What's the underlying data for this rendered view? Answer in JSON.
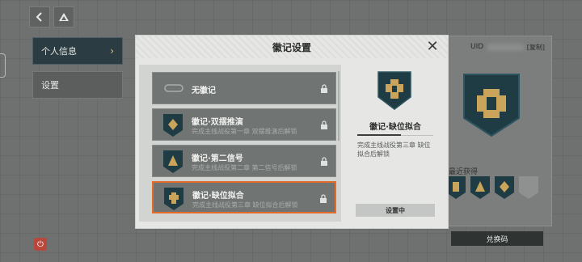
{
  "dialog": {
    "title": "徽记设置",
    "items": [
      {
        "name": "无徽记",
        "desc": ""
      },
      {
        "name": "徽记·双摆推演",
        "desc": "完成主线战役第一章 双摆推演后解锁"
      },
      {
        "name": "徽记·第二信号",
        "desc": "完成主线战役第二章 第二信号后解锁"
      },
      {
        "name": "徽记·缺位拟合",
        "desc": "完成主线战役第三章 缺位拟合后解锁"
      }
    ],
    "selected_index": 3,
    "detail": {
      "name": "徽记·缺位拟合",
      "desc": "完成主线战役第三章 缺位拟合后解锁",
      "button": "设置中"
    }
  },
  "sidebar": {
    "items": [
      {
        "label": "个人信息"
      },
      {
        "label": "设置"
      }
    ]
  },
  "profile": {
    "uid_label": "UID",
    "copy_label": "[复制]",
    "recent_label": "最近获得",
    "exchange_button": "兑换码"
  },
  "icons": {
    "back": "back-arrow-icon",
    "drive": "triangle-logo-icon",
    "close": "close-icon",
    "lock": "lock-icon",
    "power": "power-icon",
    "chevron": "chevron-right-icon"
  },
  "colors": {
    "accent_selected": "#e46b2a",
    "badge_dark": "#1f3c44",
    "badge_gold": "#c9a45a"
  }
}
